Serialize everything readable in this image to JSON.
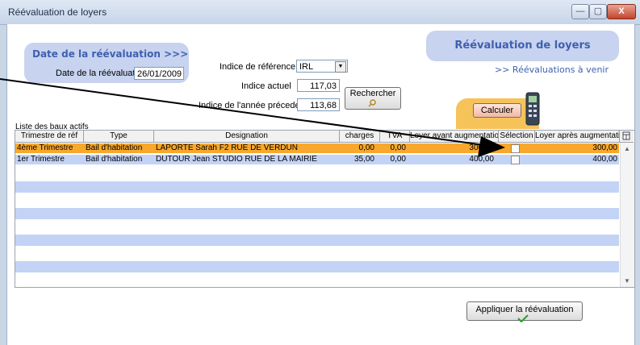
{
  "window": {
    "title": "Réévaluation de loyers",
    "controls": {
      "minimize": "—",
      "maximize": "▢",
      "close": "X"
    }
  },
  "date_panel": {
    "heading": "Date de la réévaluation >>>",
    "date_label": "Date de la réévaluation",
    "date_value": "26/01/2009"
  },
  "indices": {
    "reference_label": "Indice de référence",
    "reference_value": "IRL",
    "actuel_label": "Indice actuel",
    "actuel_value": "117,03",
    "precedent_label": "Indice de l'année précedente",
    "precedent_value": "113,68",
    "search_button": "Rechercher"
  },
  "header_box": {
    "title": "Réévaluation de loyers",
    "link": ">> Réévaluations à venir"
  },
  "calc_button": "Calculer",
  "list": {
    "caption": "Liste des baux actifs",
    "columns": [
      "Trimestre de réf",
      "Type",
      "Designation",
      "charges",
      "TVA",
      "Loyer avant augmentation",
      "Sélection",
      "Loyer après augmentation"
    ],
    "rows": [
      {
        "trimestre": "4ème Trimestre",
        "type": "Bail d'habitation",
        "designation": "LAPORTE Sarah F2 RUE DE VERDUN",
        "charges": "0,00",
        "tva": "0,00",
        "avant": "300,00",
        "apres": "300,00",
        "selected": false
      },
      {
        "trimestre": "1er Trimestre",
        "type": "Bail d'habitation",
        "designation": "DUTOUR Jean STUDIO RUE DE LA MAIRIE",
        "charges": "35,00",
        "tva": "0,00",
        "avant": "400,00",
        "apres": "400,00",
        "selected": false
      }
    ]
  },
  "apply_button": "Appliquer la réévaluation",
  "colors": {
    "highlight_row": "#f7a82d",
    "stripe": "#c3d3f5",
    "panel": "#c7d3ef",
    "accent_text": "#3f5fb0"
  }
}
